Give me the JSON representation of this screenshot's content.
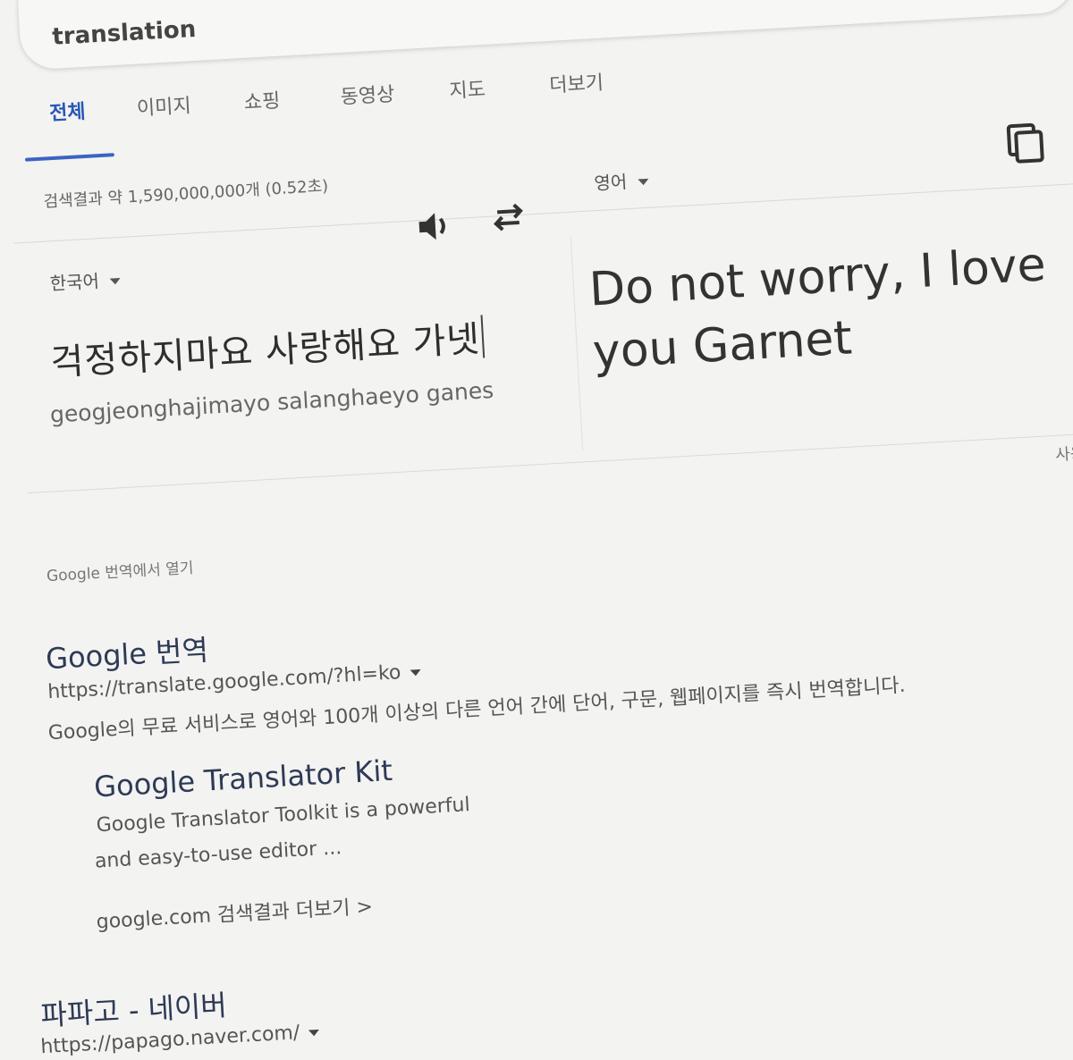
{
  "search": {
    "query": "translation"
  },
  "tabs": [
    "전체",
    "이미지",
    "쇼핑",
    "동영상",
    "지도",
    "더보기"
  ],
  "results_count": "검색결과 약 1,590,000,000개 (0.52초)",
  "translator": {
    "source_lang": "한국어",
    "target_lang": "영어",
    "source_text": "걱정하지마요 사랑해요 가넷",
    "romanization": "geogjeonghajimayo salanghaeyo ganes",
    "target_text": "Do not worry, I love you Garnet",
    "feedback": "사용",
    "open_in": "Google 번역에서 열기"
  },
  "results": [
    {
      "title": "Google 번역",
      "url": "https://translate.google.com/?hl=ko",
      "snippet": "Google의 무료 서비스로 영어와 100개 이상의 다른 언어 간에 단어, 구문, 웹페이지를 즉시 번역합니다.",
      "sublink": {
        "title": "Google Translator Kit",
        "snippet_line1": "Google Translator Toolkit is a powerful",
        "snippet_line2": "and easy-to-use editor ..."
      },
      "more": "google.com 검색결과 더보기 >"
    },
    {
      "title": "파파고 - 네이버",
      "url": "https://papago.naver.com/"
    }
  ],
  "icons": {
    "speaker": "speaker-icon",
    "swap": "swap-arrows-icon",
    "copy": "copy-icon",
    "dropdown": "chevron-down-icon"
  },
  "colors": {
    "active_tab": "#2857b8",
    "background": "#f3f3f1"
  }
}
